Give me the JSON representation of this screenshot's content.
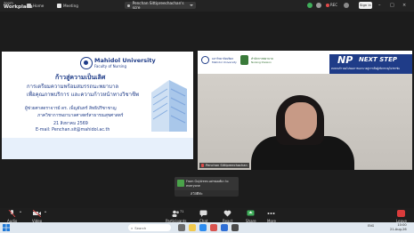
{
  "app": {
    "brand_line1": "zoom",
    "brand_line2": "Workplace"
  },
  "top_tabs": [
    {
      "label": "Home"
    },
    {
      "label": "Meeting"
    }
  ],
  "meeting_dropdown": {
    "label": "Penchan Sittipreechachan's scre"
  },
  "status": {
    "rec_label": "REC",
    "signin_label": "Sign in"
  },
  "slide": {
    "university": "Mahidol University",
    "faculty": "Faculty of Nursing",
    "title": "ก้าวสู่ความเป็นเลิศ",
    "subtitle1": "การเตรียมความพร้อมสมรรถนะพยาบาล",
    "subtitle2": "เพื่อคุณภาพบริการ และความก้าวหน้าทางวิชาชีพ",
    "presenter": "ผู้ช่วยศาสตราจารย์ ดร. เพ็ญจันทร์ สิทธิปรีชาชาญ",
    "department": "ภาควิชาการพยาบาลศาสตร์สาธารณสุขศาสตร์",
    "date": "21 สิงหาคม 2569",
    "email": "E-mail: Penchan.sit@mahidol.ac.th"
  },
  "camera": {
    "banner_text1": "มหาวิทยาลัยมหิดล",
    "banner_text2": "Mahidol University",
    "banner_text3": "สำนักการพยาบาล",
    "banner_text4": "Nursing Division",
    "np_label": "NP",
    "next_step_label": "NEXT STEP",
    "np_subtitle": "ทบทวนก้าวต่อไปของการพยาบาลสู่การเป็นผู้เชี่ยวชาญในวิชาชีพ",
    "participant_name": "Penchan Sittipreechachan"
  },
  "notification": {
    "from": "From Gujdrees ผศรพเยพัยว to",
    "to": "everyone",
    "message": "สวัสดีค่ะ"
  },
  "toolbar": {
    "audio": "Audio",
    "video": "Video",
    "participants": "Participants",
    "participants_count": "71",
    "chat": "Chat",
    "react": "React",
    "share": "Share",
    "more": "More",
    "leave": "Leave"
  },
  "taskbar": {
    "search_placeholder": "Search",
    "time": "10:00",
    "date": "21-Aug-26",
    "lang": "ENG"
  },
  "colors": {
    "brand_blue": "#1f3c88",
    "leave_red": "#d93b3b",
    "rec_red": "#e04a4a"
  }
}
